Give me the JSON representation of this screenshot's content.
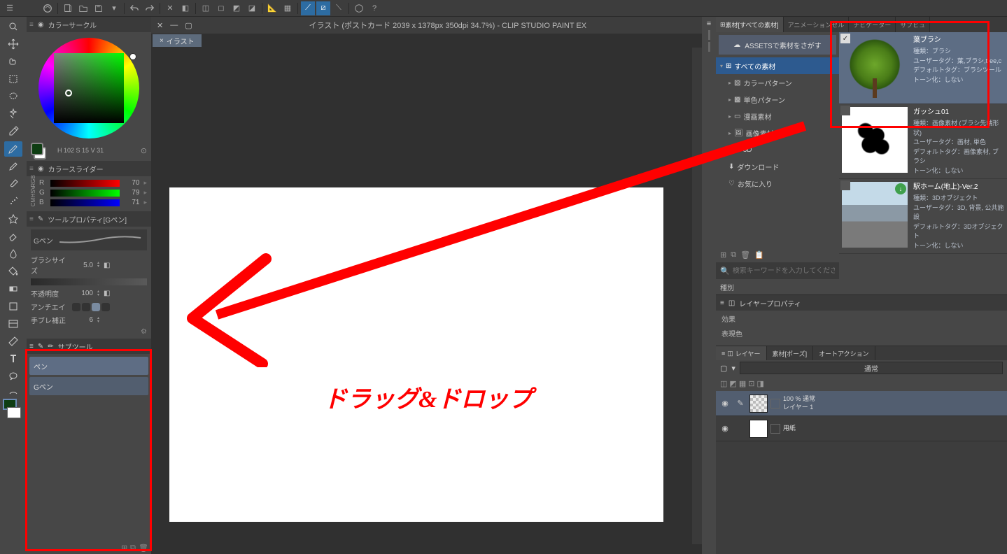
{
  "window": {
    "title": "イラスト (ポストカード 2039 x 1378px 350dpi 34.7%)  - CLIP STUDIO PAINT EX",
    "tab_label": "イラスト",
    "tab_close": "×"
  },
  "panels": {
    "color_circle": {
      "title": "カラーサークル",
      "h": "102",
      "s": "15",
      "v": "31",
      "row_vals": "H 102  S 15  V 31"
    },
    "color_slider": {
      "title": "カラースライダー",
      "r_label": "R",
      "g_label": "G",
      "b_label": "B",
      "r": "70",
      "g": "79",
      "b": "71",
      "mode_rgb": "RGB",
      "mode_hsv": "HSV",
      "mode_cmyk": "CM"
    },
    "tool_property": {
      "title": "ツールプロパティ[Gペン]",
      "preset": "Gペン",
      "brush_size_label": "ブラシサイズ",
      "brush_size": "5.0",
      "opacity_label": "不透明度",
      "opacity": "100",
      "anti_label": "アンチエイ",
      "stabilize_label": "手ブレ補正",
      "stabilize": "6"
    },
    "subtool": {
      "title": "サブツール",
      "items": [
        "ペン",
        "Gペン"
      ]
    }
  },
  "materials": {
    "tabs": [
      "素材[すべての素材]",
      "アニメーションセル",
      "ナビゲーター",
      "サブビュ"
    ],
    "assets_btn": "ASSETSで素材をさがす",
    "tree": [
      {
        "label": "すべての素材",
        "active": true
      },
      {
        "label": "カラーパターン"
      },
      {
        "label": "単色パターン"
      },
      {
        "label": "漫画素材"
      },
      {
        "label": "画像素材"
      },
      {
        "label": "3D"
      },
      {
        "label": "ダウンロード"
      },
      {
        "label": "お気に入り"
      }
    ],
    "search_placeholder": "検索キーワードを入力してください。",
    "kind_label": "種別",
    "items": [
      {
        "name": "葉ブラシ",
        "l1": "種類：ブラシ",
        "l2": "ユーザータグ：葉,ブラシ,tree,c",
        "l3": "デフォルトタグ：ブラシツール",
        "l4": "トーン化：しない"
      },
      {
        "name": "ガッシュ01",
        "l1": "種類：画像素材 (ブラシ先端形状)",
        "l2": "ユーザータグ：画材, 単色",
        "l3": "デフォルトタグ：画像素材, ブラシ",
        "l4": "トーン化：しない"
      },
      {
        "name": "駅ホーム(地上)-Ver.2",
        "l1": "種類：3Dオブジェクト",
        "l2": "ユーザータグ：3D, 背景, 公共施設",
        "l3": "デフォルトタグ：3Dオブジェクト",
        "l4": "トーン化：しない"
      }
    ]
  },
  "layer_property": {
    "title": "レイヤープロパティ",
    "effect": "効果",
    "color": "表現色"
  },
  "layers": {
    "tabs": [
      "レイヤー",
      "素材[ポーズ]",
      "オートアクション"
    ],
    "blend": "通常",
    "items": [
      {
        "opacity": "100 % 通常",
        "name": "レイヤー 1"
      },
      {
        "opacity": "",
        "name": "用紙"
      }
    ]
  },
  "annotation": "ドラッグ&ドロップ"
}
